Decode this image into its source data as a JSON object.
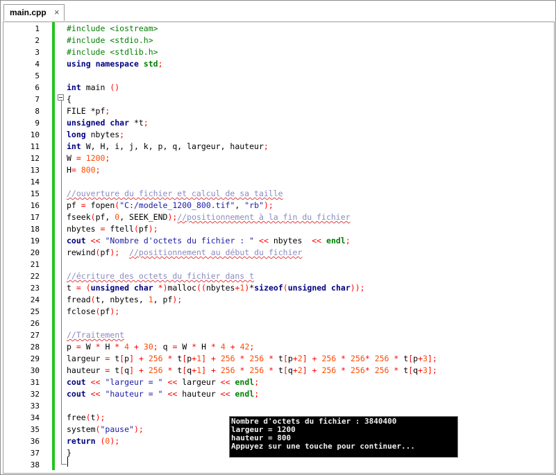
{
  "tab": {
    "label": "main.cpp",
    "close_glyph": "×"
  },
  "lines": [
    {
      "n": "1",
      "text": "#include <iostream>"
    },
    {
      "n": "2",
      "text": "#include <stdio.h>"
    },
    {
      "n": "3",
      "text": "#include <stdlib.h>"
    },
    {
      "n": "4",
      "text": "using namespace std;"
    },
    {
      "n": "5",
      "text": ""
    },
    {
      "n": "6",
      "text": "int main ()"
    },
    {
      "n": "7",
      "text": "{"
    },
    {
      "n": "8",
      "text": "FILE *pf;"
    },
    {
      "n": "9",
      "text": "unsigned char *t;"
    },
    {
      "n": "10",
      "text": "long nbytes;"
    },
    {
      "n": "11",
      "text": "int W, H, i, j, k, p, q, largeur, hauteur;"
    },
    {
      "n": "12",
      "text": "W = 1200;"
    },
    {
      "n": "13",
      "text": "H= 800;"
    },
    {
      "n": "14",
      "text": ""
    },
    {
      "n": "15",
      "text": "//ouverture du fichier et calcul de sa taille"
    },
    {
      "n": "16",
      "text": "pf = fopen(\"C:/modele_1200_800.tif\", \"rb\");"
    },
    {
      "n": "17",
      "text": "fseek(pf, 0, SEEK_END);//positionnement à la fin du fichier"
    },
    {
      "n": "18",
      "text": "nbytes = ftell(pf);"
    },
    {
      "n": "19",
      "text": "cout << \"Nombre d'octets du fichier : \" << nbytes  << endl;"
    },
    {
      "n": "20",
      "text": "rewind(pf);  //positionnement au début du fichier"
    },
    {
      "n": "21",
      "text": ""
    },
    {
      "n": "22",
      "text": "//écriture des octets du fichier dans t"
    },
    {
      "n": "23",
      "text": "t = (unsigned char *)malloc((nbytes+1)*sizeof(unsigned char));"
    },
    {
      "n": "24",
      "text": "fread(t, nbytes, 1, pf);"
    },
    {
      "n": "25",
      "text": "fclose(pf);"
    },
    {
      "n": "26",
      "text": ""
    },
    {
      "n": "27",
      "text": "//Traitement"
    },
    {
      "n": "28",
      "text": "p = W * H * 4 + 30; q = W * H * 4 + 42;"
    },
    {
      "n": "29",
      "text": "largeur = t[p] + 256 * t[p+1] + 256 * 256 * t[p+2] + 256 * 256* 256 * t[p+3];"
    },
    {
      "n": "30",
      "text": "hauteur = t[q] + 256 * t[q+1] + 256 * 256 * t[q+2] + 256 * 256* 256 * t[q+3];"
    },
    {
      "n": "31",
      "text": "cout << \"largeur = \" << largeur << endl;"
    },
    {
      "n": "32",
      "text": "cout << \"hauteur = \" << hauteur << endl;"
    },
    {
      "n": "33",
      "text": ""
    },
    {
      "n": "34",
      "text": "free(t);"
    },
    {
      "n": "35",
      "text": "system(\"pause\");"
    },
    {
      "n": "36",
      "text": "return (0);"
    },
    {
      "n": "37",
      "text": "}"
    },
    {
      "n": "38",
      "text": ""
    }
  ],
  "console": {
    "lines": [
      "Nombre d'octets du fichier : 3840400",
      "largeur = 1200",
      "hauteur = 800",
      "Appuyez sur une touche pour continuer..."
    ]
  },
  "colors": {
    "keyword": "#00007f",
    "preprocessor": "#007f00",
    "number": "#ff4a00",
    "operator": "#ff0000",
    "comment": "#8a8ac0",
    "change_bar": "#22c31f"
  }
}
